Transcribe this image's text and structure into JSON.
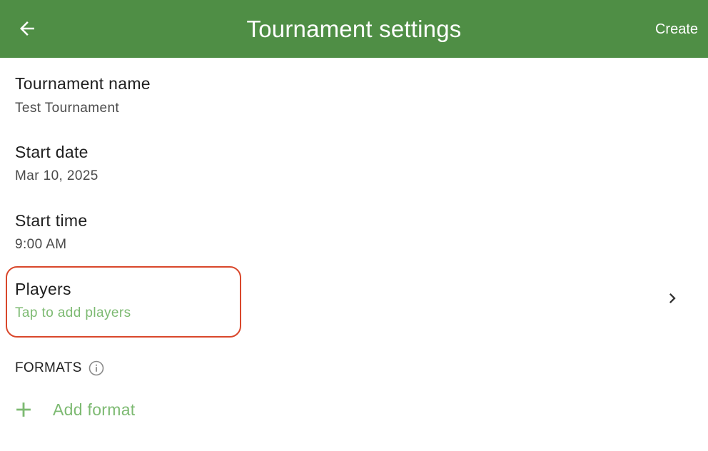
{
  "colors": {
    "brand": "#4f8e45",
    "accent": "#7dba72",
    "highlight": "#d9472b"
  },
  "appbar": {
    "back_icon": "arrow-left-icon",
    "title": "Tournament settings",
    "action_label": "Create"
  },
  "fields": {
    "name": {
      "title": "Tournament name",
      "value": "Test Tournament"
    },
    "date": {
      "title": "Start date",
      "value": "Mar 10, 2025"
    },
    "time": {
      "title": "Start time",
      "value": "9:00 AM"
    },
    "players": {
      "title": "Players",
      "hint": "Tap to add players",
      "trailing_icon": "chevron-right-icon"
    }
  },
  "formats": {
    "section_label": "FORMATS",
    "info_icon": "info-icon",
    "add_icon": "plus-icon",
    "add_label": "Add format"
  }
}
